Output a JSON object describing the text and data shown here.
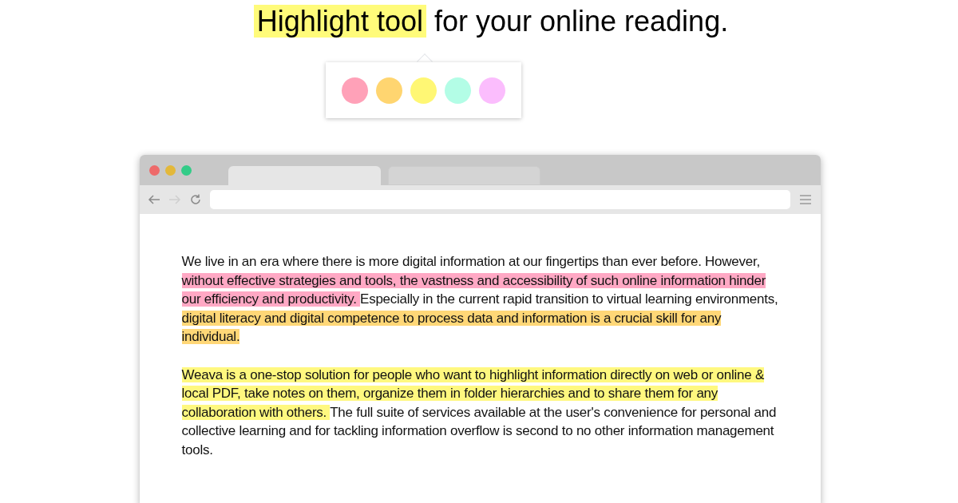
{
  "headline": [
    {
      "text": "Highlight tool",
      "color": "#fffb7a"
    },
    {
      "text": " for your online reading."
    }
  ],
  "palette": [
    {
      "color": "#ffa1b8"
    },
    {
      "color": "#ffd570"
    },
    {
      "color": "#fff774"
    },
    {
      "color": "#b3fde6"
    },
    {
      "color": "#fbbdfd"
    }
  ],
  "browser": {
    "tabs": [
      {
        "selected": true
      },
      {
        "selected": false
      }
    ],
    "nav": [
      {
        "kind": "back",
        "disabled": false
      },
      {
        "kind": "forward",
        "disabled": true
      },
      {
        "kind": "reload",
        "disabled": false
      }
    ],
    "paragraphs": [
      [
        {
          "text": "We live in an era where there is more digital information at our fingertips than ever before. However, "
        },
        {
          "text": "without effective strategies and tools, the vastness and accessibility of such online information hinder our efficiency and productivity. ",
          "color": "#ffa8c4"
        },
        {
          "text": "Especially in the current rapid transition to virtual learning environments, "
        },
        {
          "text": "digital literacy and digital competence to process data and information is a crucial skill for any individual.",
          "color": "#ffd777"
        }
      ],
      [
        {
          "text": "Weava is a one-stop solution for people who want to highlight information directly on web or online & local PDF, take notes on them, organize them in folder hierarchies and to share them for any collaboration with others. ",
          "color": "#fff87f"
        },
        {
          "text": "The full suite of services available at the user's convenience for personal and collective learning and for tackling information overflow is second to no other information management tools."
        }
      ]
    ]
  }
}
